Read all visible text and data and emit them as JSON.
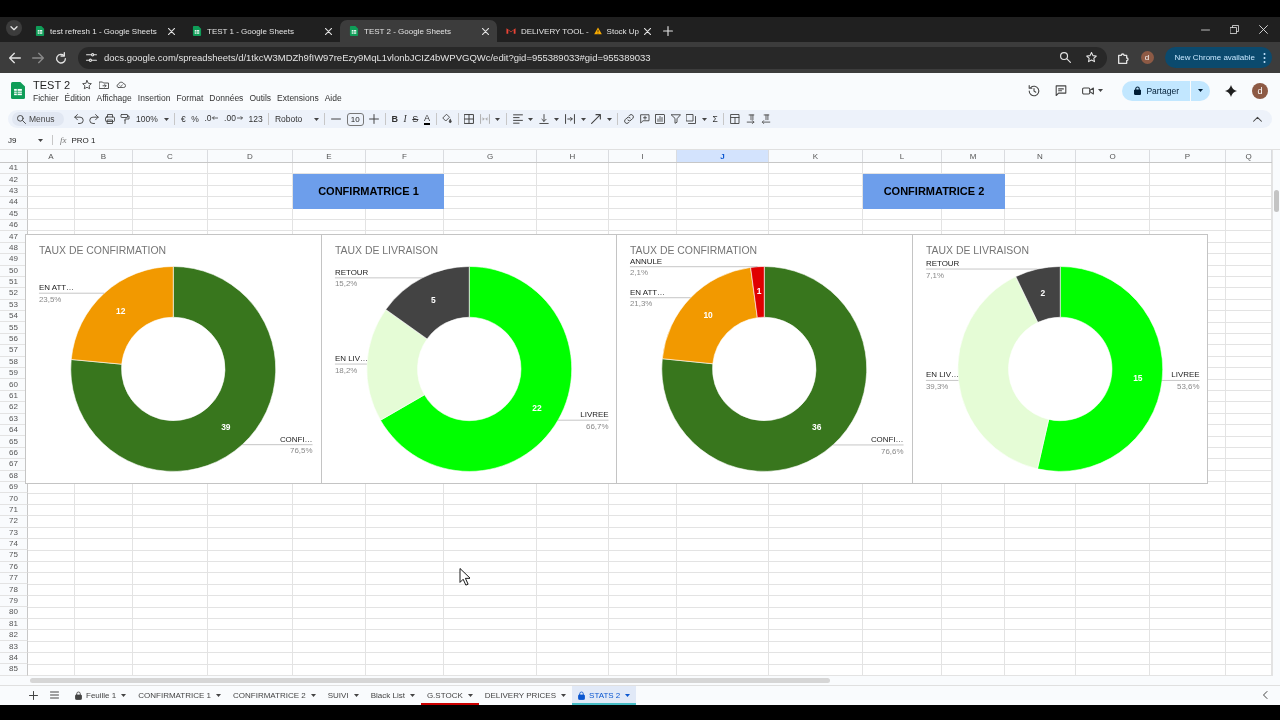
{
  "browser": {
    "tabs": [
      {
        "title": "test refresh 1 - Google Sheets",
        "kind": "sheets",
        "warning": false,
        "selected": false
      },
      {
        "title": "TEST 1 - Google Sheets",
        "kind": "sheets",
        "warning": false,
        "selected": false
      },
      {
        "title": "TEST 2 - Google Sheets",
        "kind": "sheets",
        "warning": false,
        "selected": true
      },
      {
        "title": "DELIVERY TOOL -",
        "title_after": "Stock Up",
        "kind": "mail",
        "warning": true,
        "selected": false
      }
    ],
    "url": "docs.google.com/spreadsheets/d/1tkcW3MDZh9fIW97reEzy9MqL1vlonbJCIZ4bWPVGQWc/edit?gid=955389033#gid=955389033",
    "profile": "d",
    "update_button": "New Chrome available"
  },
  "app": {
    "title": "TEST 2",
    "menu": [
      "Fichier",
      "Édition",
      "Affichage",
      "Insertion",
      "Format",
      "Données",
      "Outils",
      "Extensions",
      "Aide"
    ],
    "share_button": "Partager",
    "profile": "d"
  },
  "toolbar": {
    "search": {
      "placeholder": "Menus"
    },
    "zoom": "100%",
    "currency": "€",
    "percent": "%",
    "decrease_decimals": ".0",
    "increase_decimals": ".00",
    "number_format": "123",
    "font": "Roboto",
    "font_size": "10",
    "bold": "B",
    "italic": "I",
    "strikethrough": "S",
    "text_color": "A",
    "functions": "Σ"
  },
  "formula_bar": {
    "cell": "J9",
    "fx": "fx",
    "value": "PRO 1"
  },
  "columns": [
    {
      "label": "A",
      "selected": false
    },
    {
      "label": "B",
      "selected": false
    },
    {
      "label": "C",
      "selected": false
    },
    {
      "label": "D",
      "selected": false
    },
    {
      "label": "E",
      "selected": false
    },
    {
      "label": "F",
      "selected": false
    },
    {
      "label": "G",
      "selected": false
    },
    {
      "label": "H",
      "selected": false
    },
    {
      "label": "I",
      "selected": false
    },
    {
      "label": "J",
      "selected": true
    },
    {
      "label": "K",
      "selected": false
    },
    {
      "label": "L",
      "selected": false
    },
    {
      "label": "M",
      "selected": false
    },
    {
      "label": "N",
      "selected": false
    },
    {
      "label": "O",
      "selected": false
    },
    {
      "label": "P",
      "selected": false
    },
    {
      "label": "Q",
      "selected": false
    }
  ],
  "rows": [
    "41",
    "42",
    "43",
    "44",
    "45",
    "46",
    "47",
    "48",
    "49",
    "50",
    "51",
    "52",
    "53",
    "54",
    "55",
    "56",
    "57",
    "58",
    "59",
    "60",
    "61",
    "62",
    "63",
    "64",
    "65",
    "66",
    "67",
    "68",
    "69",
    "70",
    "71",
    "72",
    "73",
    "74",
    "75",
    "76",
    "77",
    "78",
    "79",
    "80",
    "81",
    "82",
    "83",
    "84",
    "85"
  ],
  "cells": [
    {
      "text": "CONFIRMATRICE 1"
    },
    {
      "text": "CONFIRMATRICE 2"
    }
  ],
  "charts": [
    {
      "chart_data": {
        "type": "donut",
        "title": "TAUX DE CONFIRMATION",
        "categories": [
          "CONFI…",
          "EN ATT…"
        ],
        "values": [
          39,
          12
        ],
        "colors": [
          "#38761d",
          "#f29900"
        ],
        "value_labels": [
          "39",
          "12"
        ],
        "annotations": [
          "76,5%",
          "23,5%"
        ]
      }
    },
    {
      "chart_data": {
        "type": "donut",
        "title": "TAUX DE LIVRAISON",
        "categories": [
          "LIVREE",
          "EN LIV…",
          "RETOUR"
        ],
        "values": [
          22,
          6,
          5
        ],
        "colors": [
          "#00ff00",
          "#e5fcd6",
          "#434343"
        ],
        "value_labels": [
          "22",
          null,
          "5"
        ],
        "annotations": [
          "66,7%",
          "18,2%",
          "15,2%"
        ]
      }
    },
    {
      "chart_data": {
        "type": "donut",
        "title": "TAUX DE CONFIRMATION",
        "categories": [
          "CONFI…",
          "EN ATT…",
          "ANNULE"
        ],
        "values": [
          36,
          10,
          1
        ],
        "colors": [
          "#38761d",
          "#f29900",
          "#e00000"
        ],
        "value_labels": [
          "36",
          "10",
          "1"
        ],
        "annotations": [
          "76,6%",
          "21,3%",
          "2,1%"
        ]
      }
    },
    {
      "chart_data": {
        "type": "donut",
        "title": "TAUX DE LIVRAISON",
        "categories": [
          "LIVREE",
          "EN LIV…",
          "RETOUR"
        ],
        "values": [
          15,
          11,
          2
        ],
        "colors": [
          "#00ff00",
          "#e5fcd6",
          "#434343"
        ],
        "value_labels": [
          "15",
          null,
          "2"
        ],
        "annotations": [
          "53,6%",
          "39,3%",
          "7,1%"
        ]
      }
    }
  ],
  "sheet_tabs": [
    {
      "label": "Feuille 1",
      "locked": true,
      "selected": false
    },
    {
      "label": "CONFIRMATRICE 1",
      "locked": false,
      "selected": false
    },
    {
      "label": "CONFIRMATRICE 2",
      "locked": false,
      "selected": false
    },
    {
      "label": "SUIVI",
      "locked": false,
      "selected": false
    },
    {
      "label": "Black List",
      "locked": false,
      "selected": false
    },
    {
      "label": "G.STOCK",
      "locked": false,
      "selected": false,
      "color": "#cc0000"
    },
    {
      "label": "DELIVERY PRICES",
      "locked": false,
      "selected": false
    },
    {
      "label": "STATS 2",
      "locked": true,
      "selected": true,
      "color": "#46bdc6"
    }
  ]
}
